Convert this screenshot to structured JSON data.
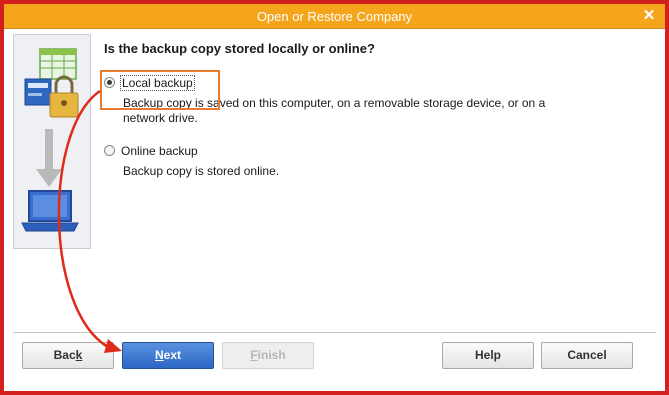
{
  "window": {
    "title": "Open or Restore Company",
    "close_glyph": "✕"
  },
  "question": "Is the backup copy stored locally or online?",
  "options": [
    {
      "label": "Local backup",
      "description": "Backup copy is saved on this computer, on a removable storage device, or on a network drive.",
      "selected": true
    },
    {
      "label": "Online backup",
      "description": "Backup copy is stored online.",
      "selected": false
    }
  ],
  "buttons": {
    "back": {
      "label_pre": "Bac",
      "label_u": "k",
      "label_post": ""
    },
    "next": {
      "label_pre": "",
      "label_u": "N",
      "label_post": "ext"
    },
    "finish": {
      "label_pre": "",
      "label_u": "F",
      "label_post": "inish"
    },
    "help": {
      "label": "Help"
    },
    "cancel": {
      "label": "Cancel"
    }
  },
  "colors": {
    "titlebar": "#f4a51c",
    "frame_border": "#d41f1f",
    "annotation_box": "#e97b2f",
    "annotation_arrow": "#e02a1a",
    "next_button": "#2d66c4"
  },
  "icons": {
    "illustration": [
      "spreadsheet-icon",
      "company-file-icon",
      "lock-icon",
      "down-arrow-icon",
      "laptop-icon"
    ],
    "close": "close-icon"
  }
}
